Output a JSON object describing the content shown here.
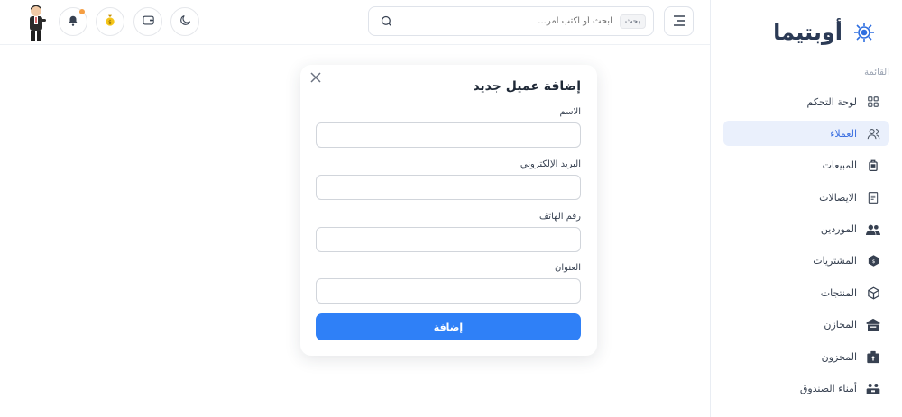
{
  "brand": {
    "name": "أوبتيما"
  },
  "sidebar": {
    "section_label": "القائمة",
    "items": [
      {
        "label": "لوحة التحكم",
        "icon": "dashboard-icon",
        "active": false
      },
      {
        "label": "العملاء",
        "icon": "users-icon",
        "active": true
      },
      {
        "label": "المبيعات",
        "icon": "shopping-bag-icon",
        "active": false
      },
      {
        "label": "الايصالات",
        "icon": "receipt-icon",
        "active": false
      },
      {
        "label": "الموردين",
        "icon": "suppliers-icon",
        "active": false
      },
      {
        "label": "المشتريات",
        "icon": "purchases-icon",
        "active": false
      },
      {
        "label": "المنتجات",
        "icon": "box-icon",
        "active": false
      },
      {
        "label": "المخازن",
        "icon": "warehouse-icon",
        "active": false
      },
      {
        "label": "المخزون",
        "icon": "inventory-icon",
        "active": false
      },
      {
        "label": "أمناء الصندوق",
        "icon": "cashiers-icon",
        "active": false
      }
    ]
  },
  "header": {
    "search": {
      "placeholder": "ابحث أو اكتب أمر...",
      "shortcut": "بحث"
    }
  },
  "modal": {
    "title": "إضافة عميل جديد",
    "fields": [
      {
        "label": "الاسم",
        "value": ""
      },
      {
        "label": "البريد الإلكتروني",
        "value": ""
      },
      {
        "label": "رقم الهاتف",
        "value": ""
      },
      {
        "label": "العنوان",
        "value": ""
      }
    ],
    "submit_label": "إضافة"
  },
  "colors": {
    "accent": "#2f80f7",
    "active_bg": "#eaf0fc",
    "active_text": "#3b6fe0",
    "notification": "#f59e42"
  }
}
